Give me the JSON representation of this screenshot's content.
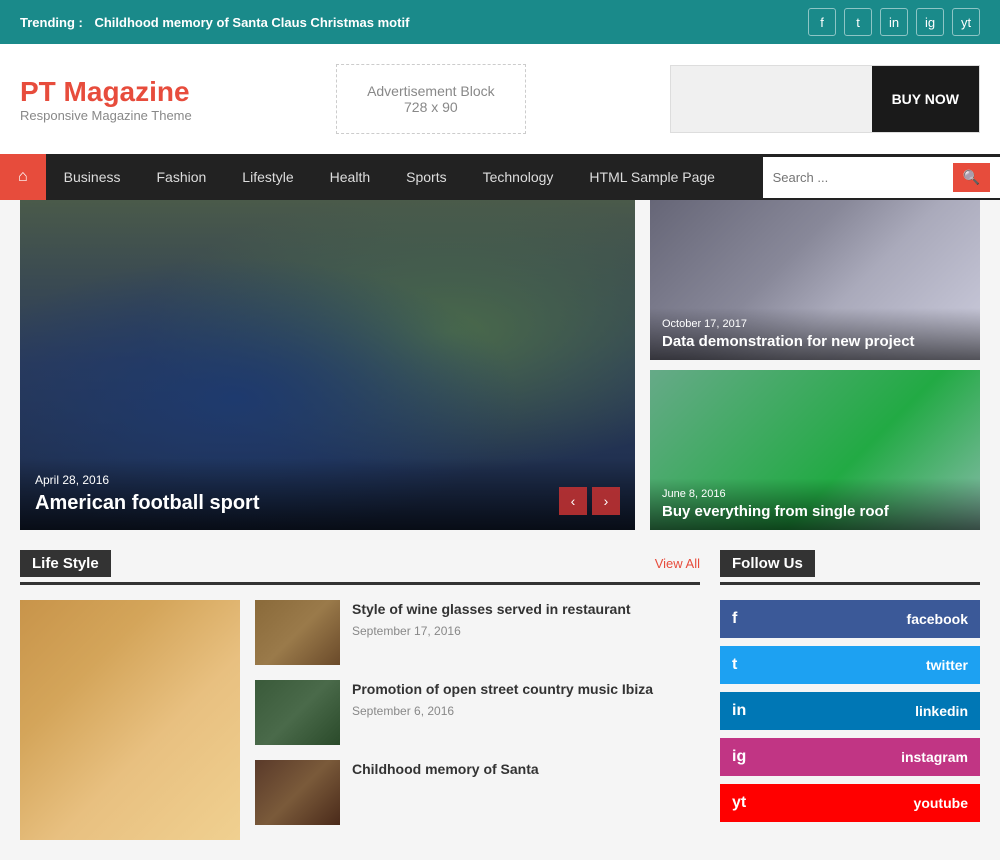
{
  "trending": {
    "label": "Trending :",
    "story": "Childhood memory of Santa Claus Christmas motif"
  },
  "social_top": [
    {
      "name": "facebook-icon",
      "symbol": "f"
    },
    {
      "name": "twitter-icon",
      "symbol": "t"
    },
    {
      "name": "linkedin-icon",
      "symbol": "in"
    },
    {
      "name": "instagram-icon",
      "symbol": "ig"
    },
    {
      "name": "youtube-icon",
      "symbol": "yt"
    }
  ],
  "header": {
    "logo": "PT Magazine",
    "tagline": "Responsive Magazine Theme",
    "ad_title": "Advertisement Block",
    "ad_size": "728 x 90",
    "buy_now": "BUY NOW"
  },
  "nav": {
    "home_icon": "⌂",
    "links": [
      {
        "label": "Business"
      },
      {
        "label": "Fashion"
      },
      {
        "label": "Lifestyle"
      },
      {
        "label": "Health"
      },
      {
        "label": "Sports"
      },
      {
        "label": "Technology"
      },
      {
        "label": "HTML Sample Page"
      }
    ],
    "search_placeholder": "Search ..."
  },
  "featured": {
    "main": {
      "date": "April 28, 2016",
      "title": "American football sport"
    },
    "side": [
      {
        "date": "October 17, 2017",
        "title": "Data demonstration for new project"
      },
      {
        "date": "June 8, 2016",
        "title": "Buy everything from single roof"
      }
    ]
  },
  "lifestyle": {
    "section_label": "Life Style",
    "view_all": "View All",
    "articles": [
      {
        "title": "Style of wine glasses served in restaurant",
        "date": "September 17, 2016"
      },
      {
        "title": "Promotion of open street country music Ibiza",
        "date": "September 6, 2016"
      },
      {
        "title": "Childhood memory of Santa",
        "date": ""
      }
    ]
  },
  "follow_us": {
    "label": "Follow Us",
    "platforms": [
      {
        "name": "facebook",
        "label": "facebook",
        "class": "sf-facebook",
        "icon": "f"
      },
      {
        "name": "twitter",
        "label": "twitter",
        "class": "sf-twitter",
        "icon": "t"
      },
      {
        "name": "linkedin",
        "label": "linkedin",
        "class": "sf-linkedin",
        "icon": "in"
      },
      {
        "name": "instagram",
        "label": "instagram",
        "class": "sf-instagram",
        "icon": "ig"
      },
      {
        "name": "youtube",
        "label": "youtube",
        "class": "sf-youtube",
        "icon": "yt"
      }
    ]
  }
}
